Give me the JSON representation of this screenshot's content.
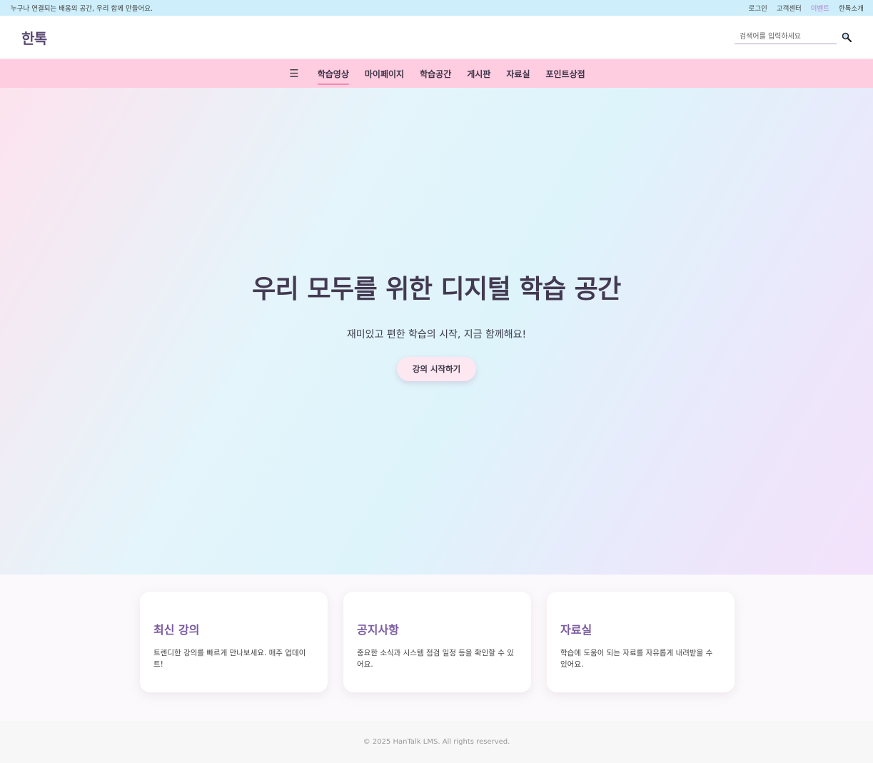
{
  "topbar": {
    "tagline": "누구나 연결되는 배움의 공간, 우리 함께 만들어요.",
    "links": [
      "로그인",
      "고객센터",
      "이벤트",
      "한톡소개"
    ]
  },
  "header": {
    "logo": "한톡",
    "search_placeholder": "검색어를 입력하세요",
    "search_icon": "search-icon"
  },
  "nav": {
    "menu_icon": "☰",
    "items": [
      "학습영상",
      "마이페이지",
      "학습공간",
      "게시판",
      "자료실",
      "포인트상점"
    ],
    "active_index": 0
  },
  "hero": {
    "title": "우리 모두를 위한 디지털 학습 공간",
    "subtitle": "재미있고 편한 학습의 시작, 지금 함께해요!",
    "button_label": "강의 시작하기"
  },
  "features": [
    {
      "title": "최신 강의",
      "desc": "트렌디한 강의를 빠르게 만나보세요. 매주 업데이트!"
    },
    {
      "title": "공지사항",
      "desc": "중요한 소식과 시스템 점검 일정 등을 확인할 수 있어요."
    },
    {
      "title": "자료실",
      "desc": "학습에 도움이 되는 자료를 자유롭게 내려받을 수 있어요."
    }
  ],
  "footer": {
    "copyright": "© 2025 HanTalk LMS. All rights reserved."
  },
  "colors": {
    "topbar_bg": "#cdeefa",
    "nav_bg": "#ffcce0",
    "accent_purple": "#7a5aa0",
    "event_link": "#b57bd6",
    "active_underline": "#f08bb0"
  }
}
